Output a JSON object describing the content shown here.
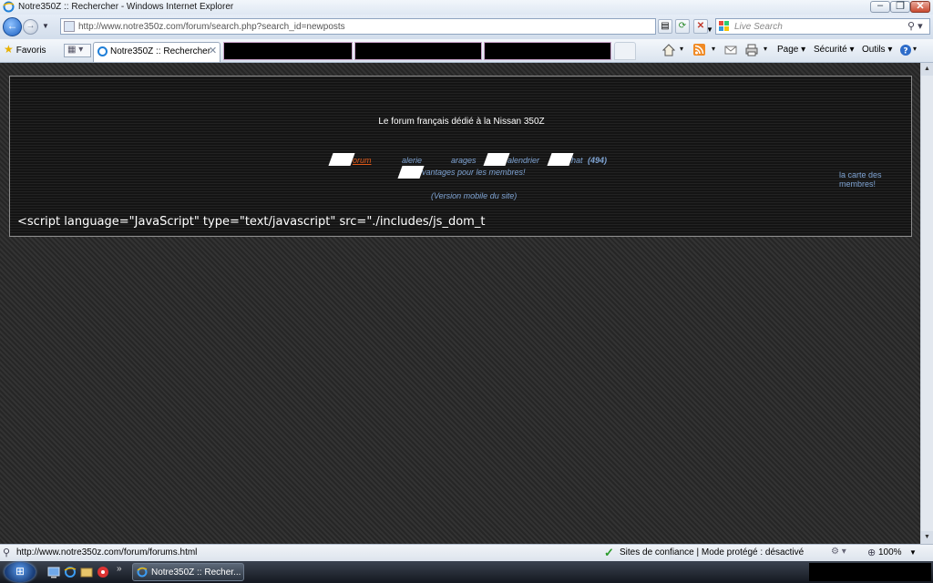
{
  "window": {
    "title": "Notre350Z :: Rechercher - Windows Internet Explorer"
  },
  "address_bar": {
    "url": "http://www.notre350z.com/forum/search.php?search_id=newposts"
  },
  "search": {
    "placeholder": "Live Search"
  },
  "favorites_label": "Favoris",
  "tab": {
    "label": "Notre350Z :: Rechercher",
    "close": "✕"
  },
  "command_bar": {
    "page": "Page",
    "security": "Sécurité",
    "tools": "Outils"
  },
  "page": {
    "tagline": "Le forum français dédié à la Nissan 350Z",
    "nav": {
      "forum": "orum",
      "gallery": "alerie",
      "garages": "arages",
      "calendar": "alendrier",
      "chat": "hat",
      "chat_count": "(494)",
      "advantages": "vantages pour les membres!",
      "mobile": "(Version mobile du site)",
      "map_line1": "la carte des",
      "map_line2": "membres!"
    },
    "script_text": "<script language=\"JavaScript\" type=\"text/javascript\" src=\"./includes/js_dom_t"
  },
  "status_bar": {
    "url": "http://www.notre350z.com/forum/forums.html",
    "zone": "Sites de confiance | Mode protégé : désactivé",
    "zoom": "100%"
  },
  "taskbar": {
    "ie_task": "Notre350Z :: Recher..."
  },
  "colors": {
    "link_accent": "#e05a1a",
    "link": "#7fa4d4"
  }
}
